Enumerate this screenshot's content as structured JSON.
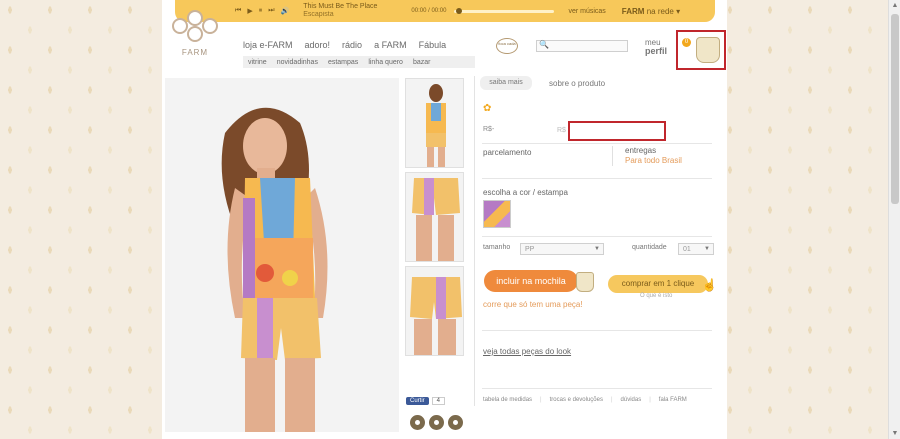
{
  "player": {
    "song_title": "This Must Be The Place",
    "song_artist": "Escapista",
    "time": "00:00 / 00:00",
    "more_music": "ver músicas",
    "rede_brand": "FARM",
    "rede_suffix": "na rede"
  },
  "logo": {
    "name": "FARM"
  },
  "nav": {
    "items": [
      "loja e-FARM",
      "adoro!",
      "rádio",
      "a FARM",
      "Fábula"
    ],
    "sub_items": [
      "vitrine",
      "novidadinhas",
      "estampas",
      "linha quero",
      "bazar"
    ],
    "badge": "foca cada"
  },
  "search": {
    "placeholder": ""
  },
  "profile": {
    "line1": "meu",
    "line2": "perfil"
  },
  "cart": {
    "count": "0"
  },
  "product": {
    "tab_saiba": "saiba mais",
    "tab_sobre": "sobre o produto",
    "price_label": "R$-",
    "price_currency": "R$",
    "parcelamento": "parcelamento",
    "entregas_title": "entregas",
    "entregas_sub": "Para todo Brasil",
    "cor_label": "escolha a cor / estampa",
    "tamanho_label": "tamanho",
    "tamanho_value": "PP",
    "quantidade_label": "quantidade",
    "quantidade_value": "01",
    "btn_mochila": "incluir na mochila",
    "btn_clique": "comprar em 1 clique",
    "saiba_mais_small": "O que é isto",
    "corre": "corre que só tem uma peça!",
    "look_link": "veja todas peças do look",
    "footer_links": [
      "tabela de medidas",
      "trocas e devoluções",
      "dúvidas",
      "fala FARM"
    ]
  },
  "social": {
    "like_label": "Curtir",
    "like_count": "4"
  }
}
